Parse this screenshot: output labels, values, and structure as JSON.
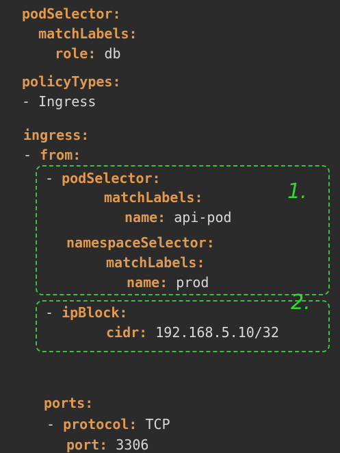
{
  "yaml": {
    "podSelector": "podSelector",
    "matchLabels": "matchLabels",
    "role_key": "role",
    "role_val": "db",
    "policyTypes": "policyTypes",
    "policy_item": "Ingress",
    "ingress": "ingress",
    "from": "from",
    "rule1": {
      "podSelector": "podSelector",
      "matchLabels": "matchLabels",
      "name_key": "name",
      "name_val": "api-pod",
      "namespaceSelector": "namespaceSelector",
      "ns_matchLabels": "matchLabels",
      "ns_name_key": "name",
      "ns_name_val": "prod"
    },
    "rule2": {
      "ipBlock": "ipBlock",
      "cidr_key": "cidr",
      "cidr_val": "192.168.5.10/32"
    },
    "ports": "ports",
    "protocol_key": "protocol",
    "protocol_val": "TCP",
    "port_key": "port",
    "port_val": "3306"
  },
  "annotations": {
    "box1_label": "1.",
    "box2_label": "2."
  },
  "colors": {
    "background": "#2b2b2b",
    "key": "#e19a52",
    "value": "#d9d9d9",
    "annotation": "#33d833"
  }
}
